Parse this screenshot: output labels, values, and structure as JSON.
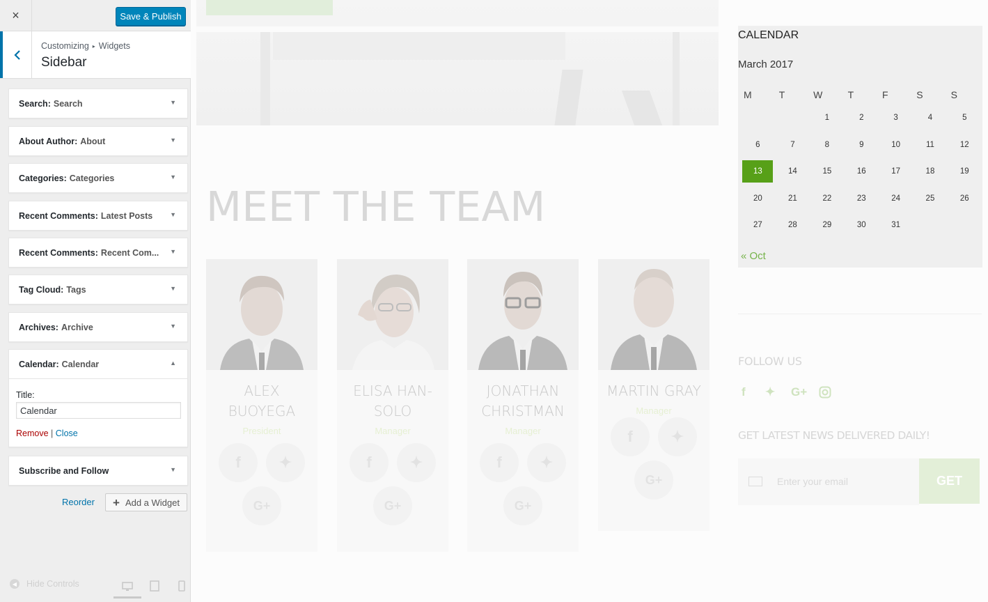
{
  "customizer": {
    "close_icon": "×",
    "save_publish": "Save & Publish",
    "breadcrumb": {
      "root": "Customizing",
      "sep": "▸",
      "current": "Widgets"
    },
    "section_title": "Sidebar",
    "widgets": [
      {
        "type": "Search:",
        "title": "Search"
      },
      {
        "type": "About Author:",
        "title": "About"
      },
      {
        "type": "Categories:",
        "title": "Categories"
      },
      {
        "type": "Recent Comments:",
        "title": "Latest Posts"
      },
      {
        "type": "Recent Comments:",
        "title": "Recent Com..."
      },
      {
        "type": "Tag Cloud:",
        "title": "Tags"
      },
      {
        "type": "Archives:",
        "title": "Archive"
      },
      {
        "type": "Calendar:",
        "title": "Calendar"
      },
      {
        "type": "Subscribe and Follow",
        "title": ""
      }
    ],
    "expanded_widget": {
      "title_label": "Title:",
      "title_value": "Calendar",
      "remove": "Remove",
      "separator": "|",
      "close": "Close"
    },
    "reorder": "Reorder",
    "add_widget": "Add a Widget",
    "hide_controls": "Hide Controls"
  },
  "preview": {
    "section_heading": "MEET THE TEAM",
    "team": [
      {
        "name": "ALEX BUOYEGA",
        "role": "President"
      },
      {
        "name": "ELISA HAN-SOLO",
        "role": "Manager"
      },
      {
        "name": "JONATHAN CHRISTMAN",
        "role": "Manager"
      },
      {
        "name": "MARTIN GRAY",
        "role": "Manager"
      }
    ],
    "calendar": {
      "heading": "CALENDAR",
      "month": "March 2017",
      "weekdays": [
        "M",
        "T",
        "W",
        "T",
        "F",
        "S",
        "S"
      ],
      "weeks": [
        [
          "",
          "",
          "1",
          "2",
          "3",
          "4",
          "5"
        ],
        [
          "6",
          "7",
          "8",
          "9",
          "10",
          "11",
          "12"
        ],
        [
          "13",
          "14",
          "15",
          "16",
          "17",
          "18",
          "19"
        ],
        [
          "20",
          "21",
          "22",
          "23",
          "24",
          "25",
          "26"
        ],
        [
          "27",
          "28",
          "29",
          "30",
          "31",
          "",
          ""
        ]
      ],
      "today": "13",
      "prev_link": "« Oct"
    },
    "follow_heading": "FOLLOW US",
    "news_heading": "GET LATEST NEWS DELIVERED DAILY!",
    "email_placeholder": "Enter your email",
    "get_button": "GET"
  },
  "colors": {
    "primary_button": "#0085ba",
    "accent_green": "#57a018",
    "link_blue": "#0073aa",
    "remove_red": "#aa0000"
  }
}
